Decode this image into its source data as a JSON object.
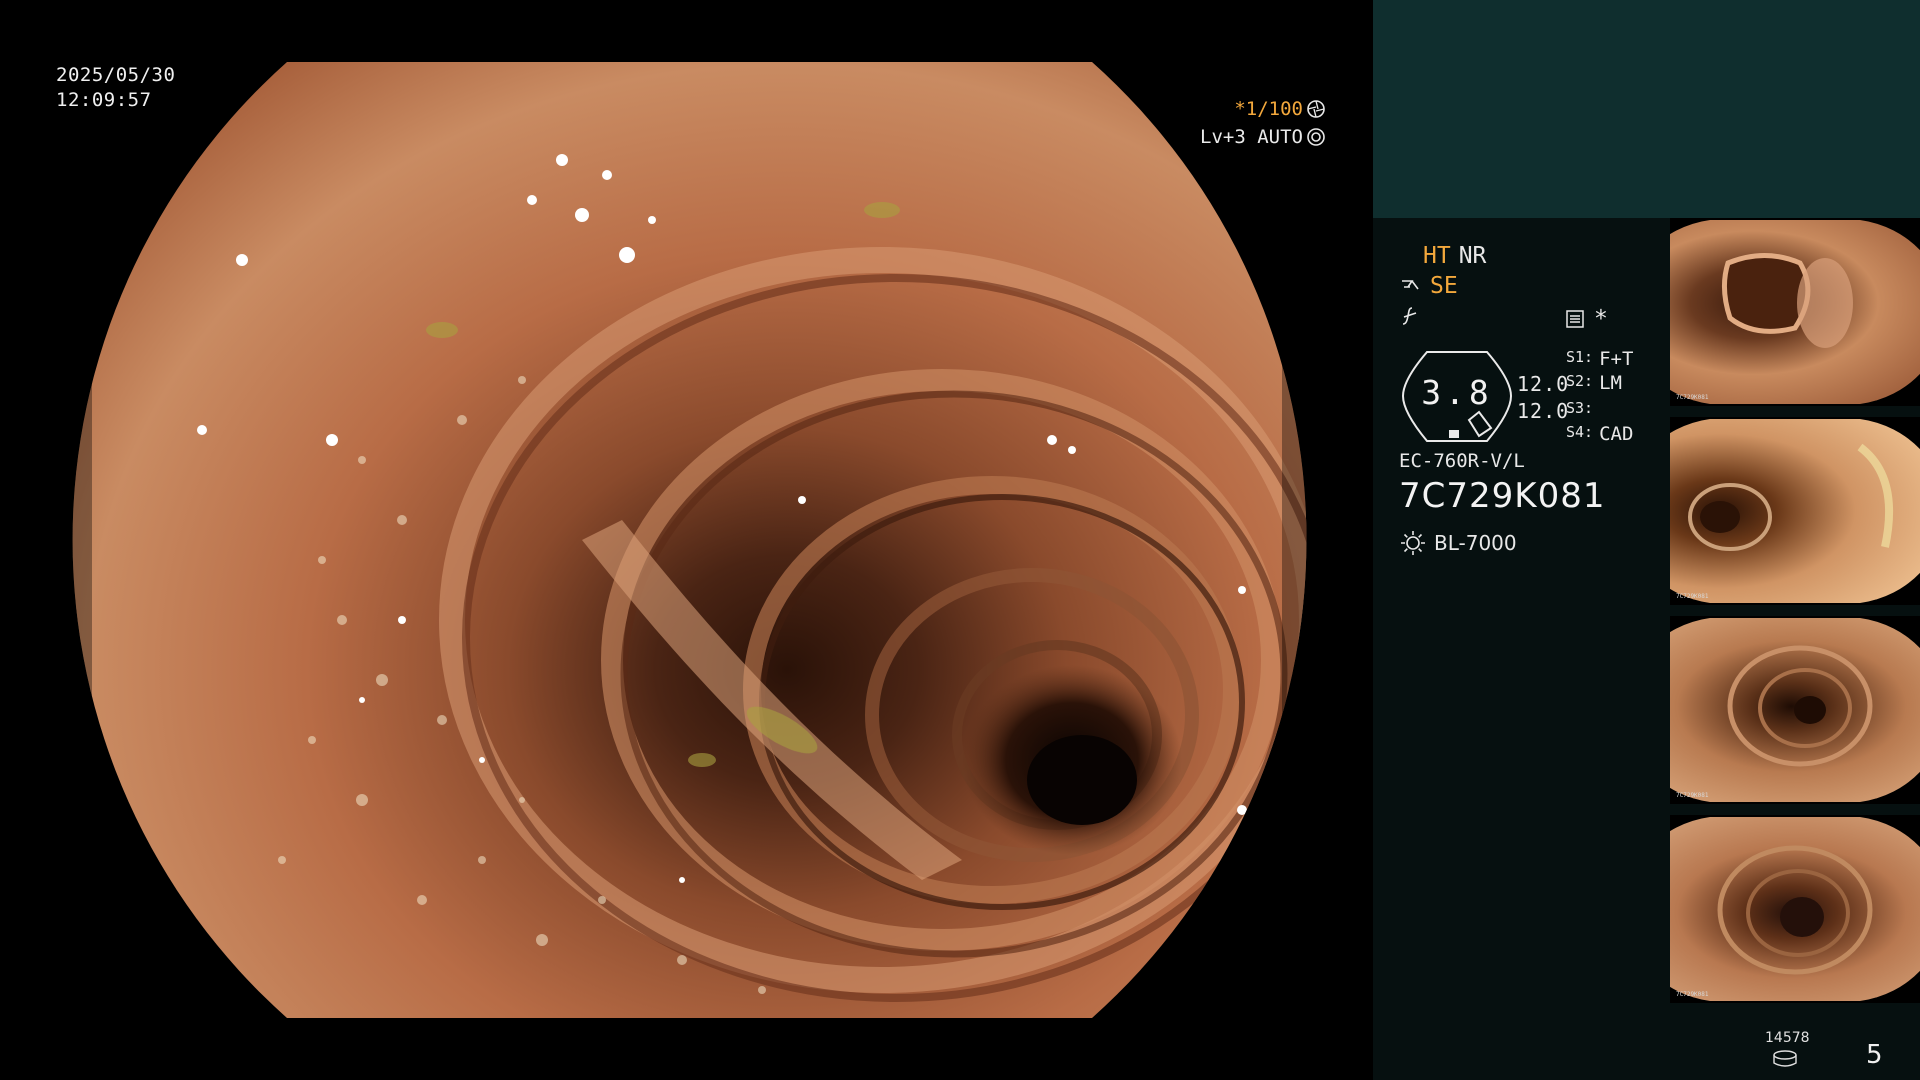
{
  "overlay": {
    "date": "2025/05/30",
    "time": "12:09:57",
    "shutter": "*1/100",
    "shutter_icon": "aperture-icon",
    "level": "Lv+3 AUTO",
    "level_icon": "auto-iris-icon"
  },
  "panel": {
    "ht": "HT",
    "nr": "NR",
    "se": "SE",
    "se_icon": "structure-enhance-icon",
    "fn_icon": "function-icon",
    "rec_icon": "record-icon",
    "asterisk": "*",
    "gauge_value": "3.8",
    "gauge_num_1": "12.0",
    "gauge_num_2": "12.0",
    "switches": [
      {
        "key": "S1:",
        "value": "F+T"
      },
      {
        "key": "S2:",
        "value": "LM"
      },
      {
        "key": "S3:",
        "value": ""
      },
      {
        "key": "S4:",
        "value": "CAD"
      }
    ],
    "scope_model": "EC-760R-V/L",
    "scope_serial": "7C729K081",
    "light_icon": "light-source-icon",
    "light_source": "BL-7000"
  },
  "thumbnails": [
    {
      "serial": "7C729K081",
      "name": "captured-image-1"
    },
    {
      "serial": "7C729K081",
      "name": "captured-image-2"
    },
    {
      "serial": "7C729K081",
      "name": "captured-image-3"
    },
    {
      "serial": "7C729K081",
      "name": "captured-image-4"
    }
  ],
  "footer": {
    "counter_icon": "storage-icon",
    "counter": "14578",
    "page": "5"
  },
  "colors": {
    "accent": "#f3a83c",
    "panel_top": "#0f2e2e",
    "panel_bg": "#061010"
  }
}
